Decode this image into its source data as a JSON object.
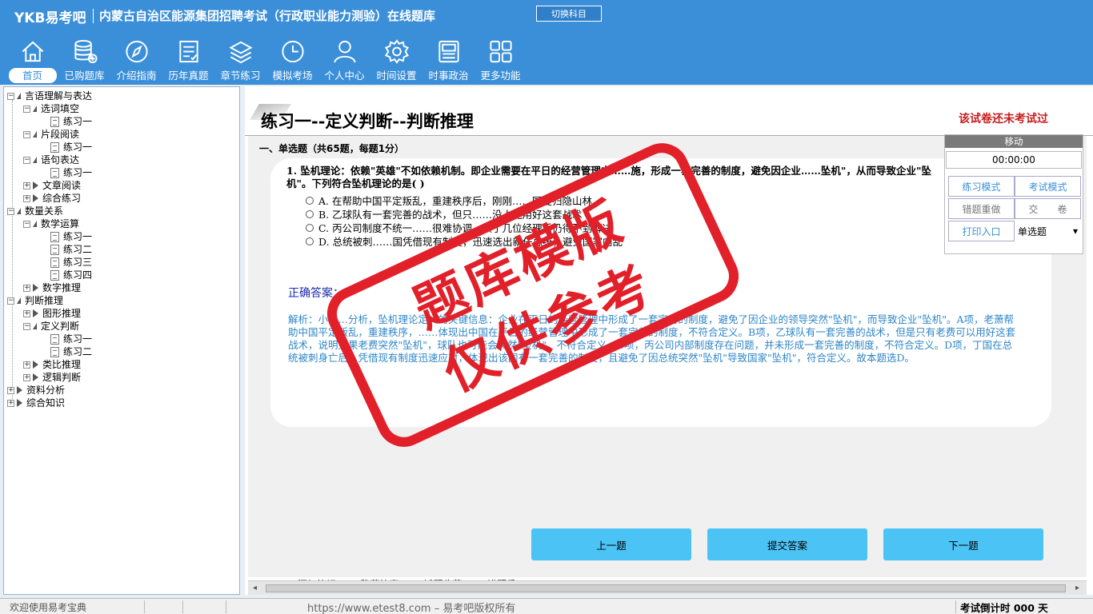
{
  "header": {
    "brand": "YKB易考吧",
    "title": "内蒙古自治区能源集团招聘考试（行政职业能力测验）在线题库",
    "switch_label": "切换科目",
    "nav": [
      {
        "label": "首页",
        "icon": "home-icon"
      },
      {
        "label": "已购题库",
        "icon": "database-icon"
      },
      {
        "label": "介绍指南",
        "icon": "compass-icon"
      },
      {
        "label": "历年真题",
        "icon": "checklist-icon"
      },
      {
        "label": "章节练习",
        "icon": "layers-icon"
      },
      {
        "label": "模拟考场",
        "icon": "clock-icon"
      },
      {
        "label": "个人中心",
        "icon": "user-icon"
      },
      {
        "label": "时间设置",
        "icon": "gear-icon"
      },
      {
        "label": "时事政治",
        "icon": "news-icon"
      },
      {
        "label": "更多功能",
        "icon": "grid-icon"
      }
    ]
  },
  "tree": [
    {
      "label": "言语理解与表达",
      "level": 0
    },
    {
      "label": "选词填空",
      "level": 1
    },
    {
      "label": "练习一",
      "level": 2
    },
    {
      "label": "片段阅读",
      "level": 1
    },
    {
      "label": "练习一",
      "level": 2
    },
    {
      "label": "语句表达",
      "level": 1
    },
    {
      "label": "练习一",
      "level": 2
    },
    {
      "label": "文章阅读",
      "level": 1
    },
    {
      "label": "综合练习",
      "level": 1
    },
    {
      "label": "数量关系",
      "level": 0
    },
    {
      "label": "数学运算",
      "level": 1
    },
    {
      "label": "练习一",
      "level": 2
    },
    {
      "label": "练习二",
      "level": 2
    },
    {
      "label": "练习三",
      "level": 2
    },
    {
      "label": "练习四",
      "level": 2
    },
    {
      "label": "数字推理",
      "level": 1
    },
    {
      "label": "判断推理",
      "level": 0
    },
    {
      "label": "图形推理",
      "level": 1
    },
    {
      "label": "定义判断",
      "level": 1
    },
    {
      "label": "练习一",
      "level": 2
    },
    {
      "label": "练习二",
      "level": 2
    },
    {
      "label": "类比推理",
      "level": 1
    },
    {
      "label": "逻辑判断",
      "level": 1
    },
    {
      "label": "资料分析",
      "level": 0
    },
    {
      "label": "综合知识",
      "level": 0
    }
  ],
  "main": {
    "page_title": "练习一--定义判断--判断推理",
    "status": "该试卷还未考试过",
    "section": "一、单选题（共65题，每题1分）",
    "question": "1. 坠机理论：依赖\"英雄\"不如依赖机制。即企业需要在平日的经营管理中……施，形成一套完善的制度，避免因企业……坠机\"，从而导致企业\"坠机\"。下列符合坠机理论的是( )",
    "options": [
      "A. 在帮助中国平定叛乱，重建秩序后，刚刚……国度归隐山林",
      "B. 乙球队有一套完善的战术，但只……没人能用好这套战术",
      "C. 丙公司制度不统一……很难协调，换了几位经理后仍得不到解决",
      "D. 总统被刺……国凭借现有制度，迅速选出新任总统，避免国家内乱"
    ],
    "answer": "正确答案：D",
    "analysis": "解析：小……分析，坠机理论定义的关键信息：企业在平日的经营管理中形成了一套完善的制度，避免了因企业的领导突然\"坠机\"，而导致企业\"坠机\"。A项，老萧帮助中国平定叛乱，重建秩序，……体现出中国在平日的经营管理中形成了一套完善的制度，不符合定义。B项，乙球队有一套完善的战术，但是只有老费可以用好这套战术，说明如果老费突然\"坠机\"，球队也可能会突然\"坠机\"，不符合定义。C项，丙公司内部制度存在问题，并未形成一套完善的制度，不符合定义。D项，丁国在总统被刺身亡后，凭借现有制度迅速应对，体现出该国有一套完善的制度，且避免了因总统突然\"坠机\"导致国家\"坠机\"，符合定义。故本题选D。",
    "tools": [
      {
        "label": "添加笔记",
        "icon": "pencil-icon"
      },
      {
        "label": "隐藏答案",
        "icon": "eye-icon"
      },
      {
        "label": "试题收藏",
        "icon": "heart-icon"
      },
      {
        "label": "错题反",
        "icon": "report-icon"
      }
    ],
    "prev": "上一题",
    "submit": "提交答案",
    "next": "下一题"
  },
  "panel": {
    "move": "移动",
    "timer": "00:00:00",
    "practice_mode": "练习模式",
    "exam_mode": "考试模式",
    "redo": "错题重做",
    "hand_in": "交　　卷",
    "print": "打印入口",
    "type_select": "单选题"
  },
  "statusbar": {
    "welcome": "欢迎使用易考宝典",
    "site": "https://www.etest8.com – 易考吧版权所有",
    "countdown": "考试倒计时 000 天"
  },
  "stamp": {
    "line1": "题库模版",
    "line2": "仅供参考"
  }
}
